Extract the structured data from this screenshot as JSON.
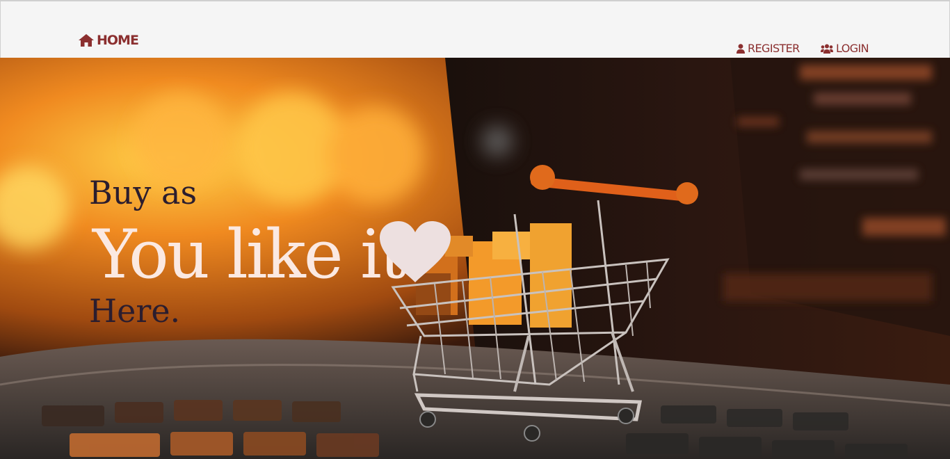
{
  "nav": {
    "home_label": "HOME",
    "register_label": "REGISTER",
    "login_label": "LOGIN",
    "link_color": "#8b2f2f"
  },
  "hero": {
    "line1": "Buy as",
    "line2": "You like it",
    "line3": "Here.",
    "accent_color": "#fbe9e2",
    "image_subject": "shopping cart on laptop keyboard"
  },
  "icons": {
    "home": "home-icon",
    "register": "user-icon",
    "login": "users-icon",
    "heart": "heart-icon"
  }
}
